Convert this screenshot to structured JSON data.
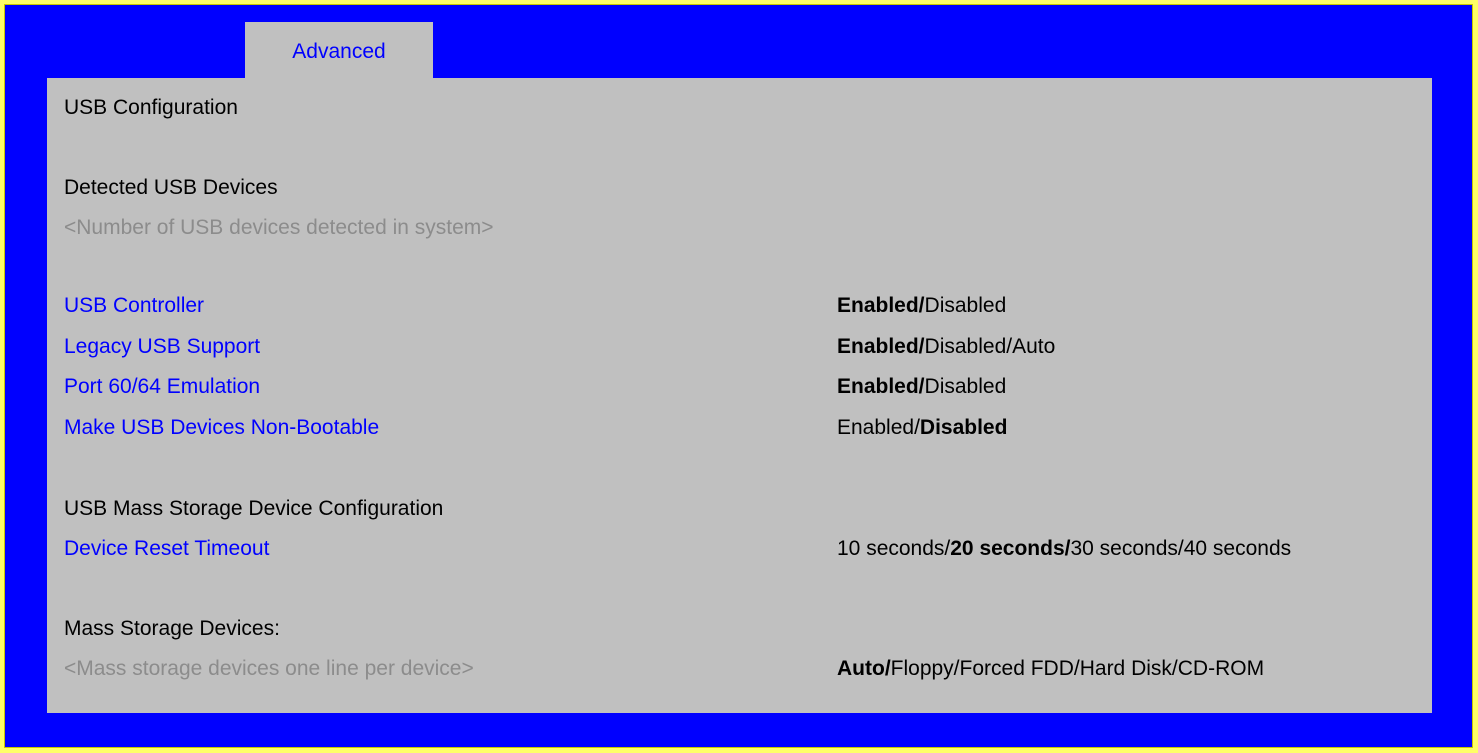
{
  "tab": {
    "label": "Advanced"
  },
  "title": "USB Configuration",
  "detected": {
    "heading": "Detected USB Devices",
    "placeholder": "<Number of USB devices detected in system>"
  },
  "settings": [
    {
      "label": "USB Controller",
      "options": [
        "Enabled",
        "Disabled"
      ],
      "default_index": 0
    },
    {
      "label": "Legacy USB Support",
      "options": [
        "Enabled",
        "Disabled",
        "Auto"
      ],
      "default_index": 0
    },
    {
      "label": "Port 60/64 Emulation",
      "options": [
        "Enabled",
        "Disabled"
      ],
      "default_index": 0
    },
    {
      "label": "Make USB Devices Non-Bootable",
      "options": [
        "Enabled",
        "Disabled"
      ],
      "default_index": 1
    }
  ],
  "mass_storage_config": {
    "heading": "USB Mass Storage Device Configuration",
    "timeout_label": "Device Reset Timeout",
    "timeout_options": [
      "10 seconds",
      "20 seconds",
      "30 seconds",
      "40 seconds"
    ],
    "timeout_default_index": 1
  },
  "mass_storage_devices": {
    "heading": "Mass Storage Devices:",
    "placeholder": "<Mass storage devices one line per device>",
    "options": [
      "Auto",
      "Floppy",
      "Forced FDD",
      "Hard Disk",
      "CD-ROM"
    ],
    "default_index": 0
  },
  "colors": {
    "background": "#0000ff",
    "panel": "#c0c0c0",
    "link": "#0000ff",
    "placeholder": "#8c8c8c",
    "page_border": "#ffff66"
  }
}
